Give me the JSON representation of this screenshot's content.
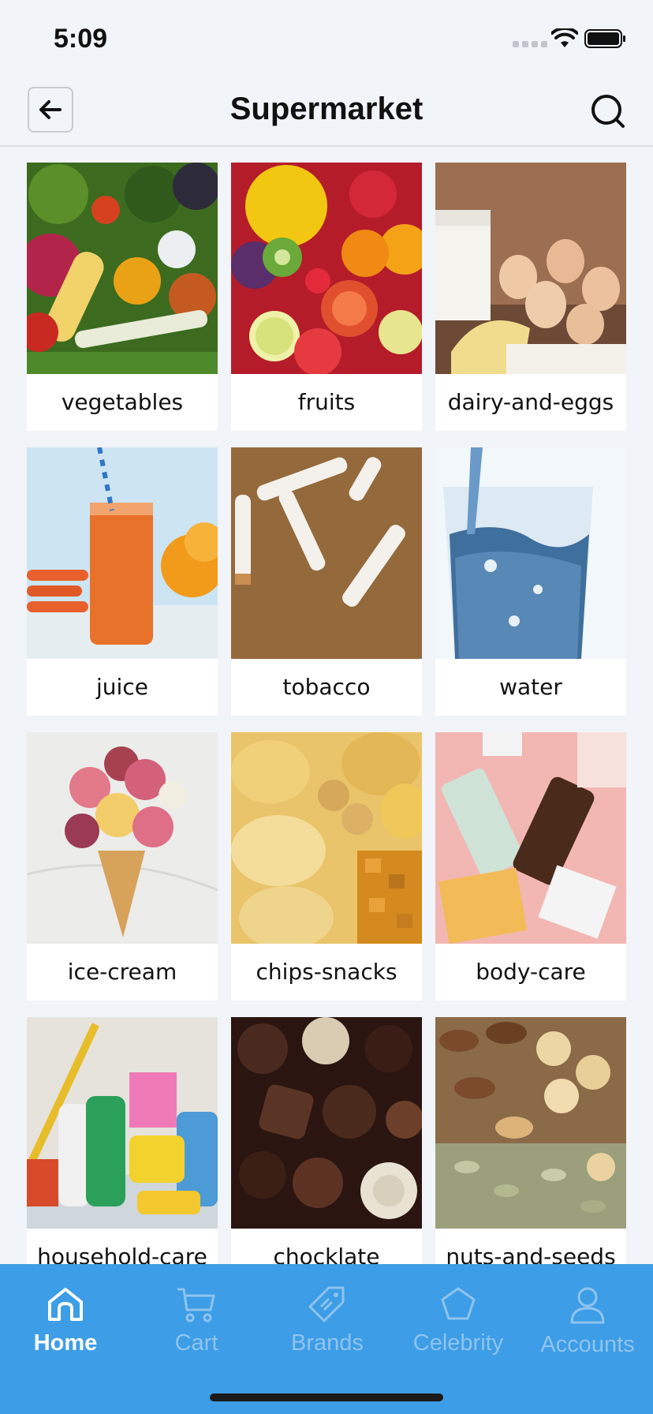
{
  "status_bar": {
    "time": "5:09"
  },
  "header": {
    "title": "Supermarket"
  },
  "categories": [
    {
      "label": "vegetables"
    },
    {
      "label": "fruits"
    },
    {
      "label": "dairy-and-eggs"
    },
    {
      "label": "juice"
    },
    {
      "label": "tobacco"
    },
    {
      "label": "water"
    },
    {
      "label": "ice-cream"
    },
    {
      "label": "chips-snacks"
    },
    {
      "label": "body-care"
    },
    {
      "label": "household-care"
    },
    {
      "label": "chocklate"
    },
    {
      "label": "nuts-and-seeds"
    }
  ],
  "tabs": [
    {
      "label": "Home",
      "icon": "home-icon",
      "active": true
    },
    {
      "label": "Cart",
      "icon": "cart-icon",
      "active": false
    },
    {
      "label": "Brands",
      "icon": "tag-icon",
      "active": false
    },
    {
      "label": "Celebrity",
      "icon": "star-icon",
      "active": false
    },
    {
      "label": "Accounts",
      "icon": "user-icon",
      "active": false
    }
  ],
  "colors": {
    "accent": "#3d9de6",
    "tab_inactive": "#8fc4ee",
    "background": "#f1f4f8"
  }
}
